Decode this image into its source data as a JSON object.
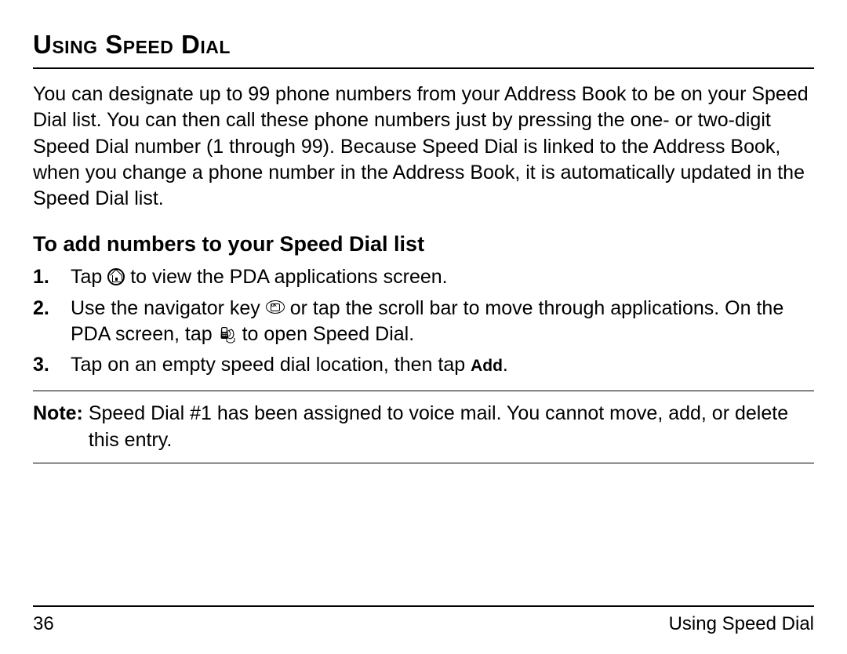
{
  "title": "Using Speed Dial",
  "intro": "You can designate up to 99 phone numbers from your Address Book to be on your Speed Dial list. You can then call these phone numbers just by pressing the one- or two-digit Speed Dial number (1 through 99). Because Speed Dial is linked to the Address Book, when you change a phone number in the Address Book, it is automatically updated in the Speed Dial list.",
  "subheading": "To add numbers to your Speed Dial list",
  "steps": {
    "s1": {
      "num": "1.",
      "a": "Tap ",
      "b": " to view the PDA applications screen."
    },
    "s2": {
      "num": "2.",
      "a": "Use the navigator key ",
      "b": " or tap the scroll bar to move through applications. On the PDA screen, tap ",
      "c": " to open Speed Dial."
    },
    "s3": {
      "num": "3.",
      "a": "Tap on an empty speed dial location, then tap ",
      "add": "Add",
      "b": "."
    }
  },
  "note": {
    "label": "Note: ",
    "body": "Speed Dial #1 has been assigned to voice mail. You cannot move, add, or delete this entry."
  },
  "footer": {
    "page": "36",
    "section": "Using Speed Dial"
  }
}
